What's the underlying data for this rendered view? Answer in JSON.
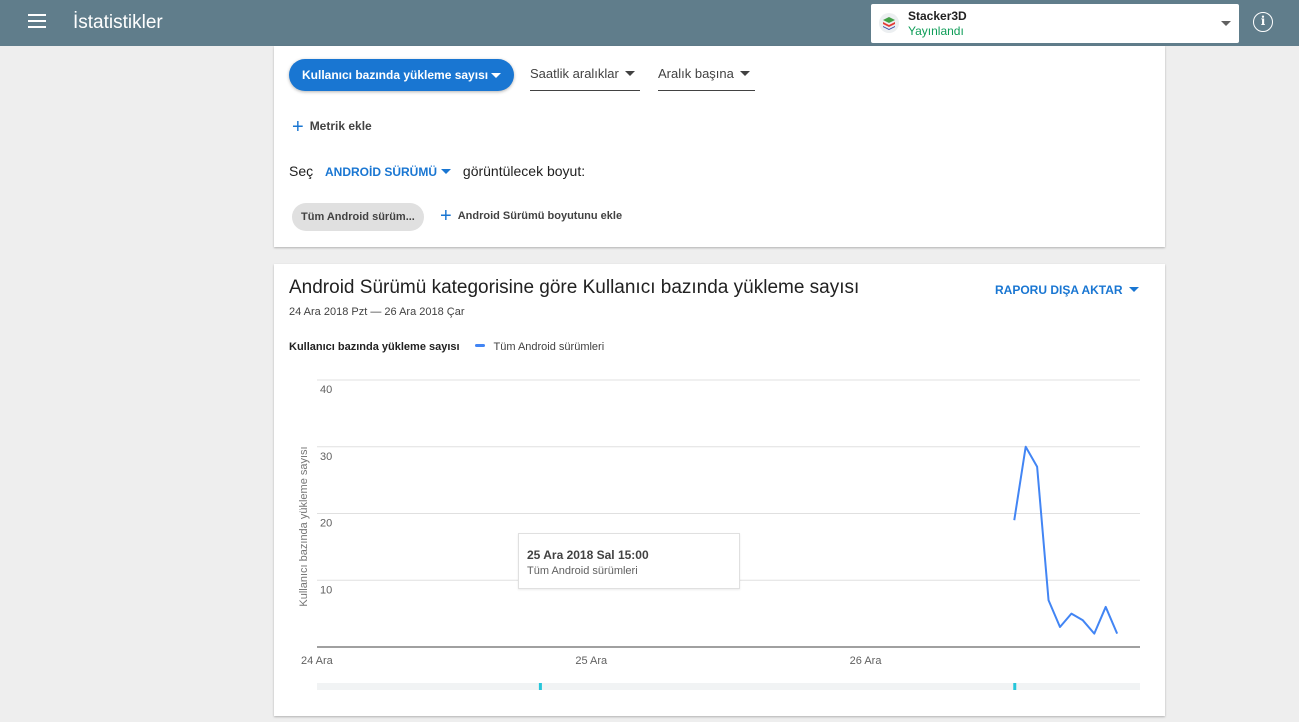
{
  "appbar": {
    "title": "İstatistikler",
    "menu_icon": "menu-icon",
    "app_name": "Stacker3D",
    "app_status": "Yayınlandı",
    "info_icon": "info-icon"
  },
  "controls": {
    "metric_button": "Kullanıcı bazında yükleme sayısı",
    "interval_dropdown": "Saatlik aralıklar",
    "aggregation_dropdown": "Aralık başına",
    "add_metric": "Metrik ekle",
    "dimension_prefix": "Seç",
    "dimension_value": "ANDROİD SÜRÜMÜ",
    "dimension_suffix": "görüntülecek boyut:",
    "filter_chip": "Tüm Android sürüm...",
    "add_dimension": "Android Sürümü boyutunu ekle"
  },
  "report": {
    "title": "Android Sürümü kategorisine göre Kullanıcı bazında yükleme sayısı",
    "date_range": "24 Ara 2018 Pzt — 26 Ara 2018 Çar",
    "export_button": "RAPORU DIŞA AKTAR",
    "legend_metric": "Kullanıcı bazında yükleme sayısı",
    "legend_series": "Tüm Android sürümleri",
    "tooltip_date": "25 Ara 2018 Sal 15:00",
    "tooltip_series": "Tüm Android sürümleri"
  },
  "colors": {
    "appbar": "#607d8b",
    "accent": "#1976d2",
    "series": "#4285f4",
    "status_published": "#0f9d58"
  },
  "chart_data": {
    "type": "line",
    "ylabel": "Kullanıcı bazında yükleme sayısı",
    "xlabel": "",
    "x_ticks": [
      "24 Ara",
      "25 Ara",
      "26 Ara"
    ],
    "y_ticks": [
      "10",
      "20",
      "30",
      "40"
    ],
    "ylim": [
      0,
      40
    ],
    "xlim_hours": [
      0,
      72
    ],
    "grid": true,
    "series": [
      {
        "name": "Tüm Android sürümleri",
        "x_hours": [
          61,
          62,
          63,
          64,
          65,
          66,
          67,
          68,
          69,
          70
        ],
        "values": [
          19,
          30,
          27,
          7,
          3,
          5,
          4,
          2,
          6,
          2
        ]
      }
    ]
  }
}
